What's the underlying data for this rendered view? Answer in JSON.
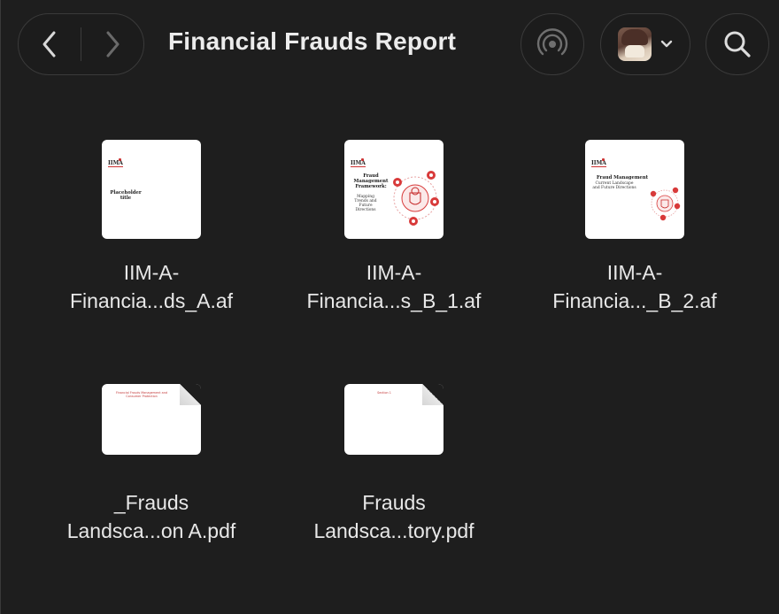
{
  "window": {
    "title": "Financial Frauds Report"
  },
  "toolbar": {
    "back_icon": "chevron-left-icon",
    "forward_icon": "chevron-right-icon",
    "airdrop_icon": "airdrop-icon",
    "share_chevron_icon": "chevron-down-icon",
    "search_icon": "search-icon"
  },
  "files": [
    {
      "name_line1": "IIM-A-",
      "name_line2": "Financia...ds_A.af",
      "thumb_logo": "IIMA",
      "thumb_title": "Placeholder title"
    },
    {
      "name_line1": "IIM-A-",
      "name_line2": "Financia...s_B_1.af",
      "thumb_logo": "IIMA",
      "thumb_title": "Fraud Management Framework:",
      "thumb_subtitle": "Mapping Trends and Future Directions"
    },
    {
      "name_line1": "IIM-A-",
      "name_line2": "Financia..._B_2.af",
      "thumb_logo": "IIMA",
      "thumb_title": "Fraud Management",
      "thumb_subtitle": "Current Landscape and Future Directions"
    },
    {
      "name_line1": "_Frauds",
      "name_line2": "Landsca...on A.pdf",
      "thumb_text": "Financial Frauds Management and Consumer Protection"
    },
    {
      "name_line1": "Frauds",
      "name_line2": "Landsca...tory.pdf",
      "thumb_text": "Section 1"
    }
  ],
  "colors": {
    "background": "#1e1e1e",
    "text": "#e8e8e8",
    "accent_red": "#d83a3a"
  }
}
